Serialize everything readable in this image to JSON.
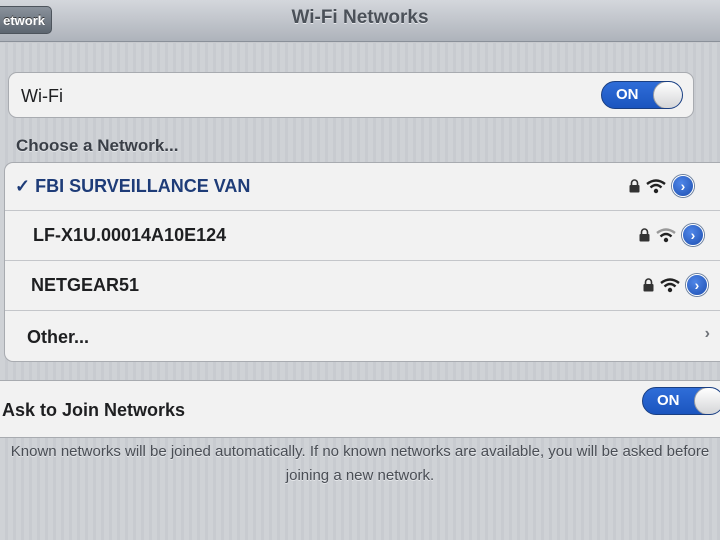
{
  "nav": {
    "back_label": "etwork",
    "title": "Wi-Fi Networks"
  },
  "wifi": {
    "label": "Wi-Fi",
    "toggle_label": "ON"
  },
  "choose": {
    "header": "Choose a Network..."
  },
  "networks": [
    {
      "name": "✓ FBI SURVEILLANCE VAN",
      "secured": true,
      "selected": true,
      "detail_icon": "chevron-right-circle-icon"
    },
    {
      "name": "LF-X1U.00014A10E124",
      "secured": true,
      "selected": false,
      "detail_icon": "chevron-right-circle-icon"
    },
    {
      "name": "NETGEAR51",
      "secured": true,
      "selected": false,
      "detail_icon": "chevron-right-circle-icon"
    }
  ],
  "other": {
    "label": "Other...",
    "chevron": "›"
  },
  "ask": {
    "label": "Ask to Join Networks",
    "toggle_label": "ON"
  },
  "footer": {
    "text": "Known networks will be joined automatically. If no known networks are available, you will be asked before joining a new network."
  },
  "colors": {
    "accent": "#1b55bf",
    "network_selected": "#1e3c78"
  }
}
